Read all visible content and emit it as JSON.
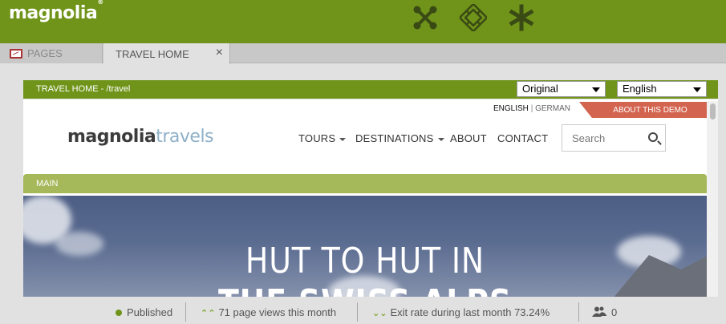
{
  "header": {
    "logo": "magnolia",
    "logo_mark": "®",
    "apps": [
      {
        "icon": "app-launcher-icon"
      },
      {
        "icon": "pulse-icon"
      },
      {
        "icon": "favorites-icon"
      }
    ]
  },
  "tabs": [
    {
      "label": "PAGES",
      "icon": "pages-icon",
      "active": false
    },
    {
      "label": "TRAVEL HOME",
      "active": true,
      "close": "×"
    }
  ],
  "preview": {
    "path": "TRAVEL HOME - /travel",
    "mode_select": "Original",
    "language_select": "English"
  },
  "site": {
    "lang_en": "ENGLISH",
    "lang_sep": "|",
    "lang_de": "GERMAN",
    "about_demo": "ABOUT THIS DEMO",
    "logo_a": "magnolia",
    "logo_b": "travels",
    "nav": {
      "tours": "TOURS",
      "destinations": "DESTINATIONS",
      "about": "ABOUT",
      "contact": "CONTACT"
    },
    "search_placeholder": "Search",
    "area_label": "MAIN",
    "hero_line1": "HUT TO HUT IN",
    "hero_line2": "THE SWISS ALPS"
  },
  "status": {
    "published": "Published",
    "page_views": "71 page views this month",
    "exit_rate": "Exit rate during last month 73.24%",
    "users": "0"
  },
  "colors": {
    "brand_green": "#6f9419",
    "area_green": "#a5b85a",
    "demo_red": "#d36450",
    "logo_blue": "#8fb1c8"
  }
}
